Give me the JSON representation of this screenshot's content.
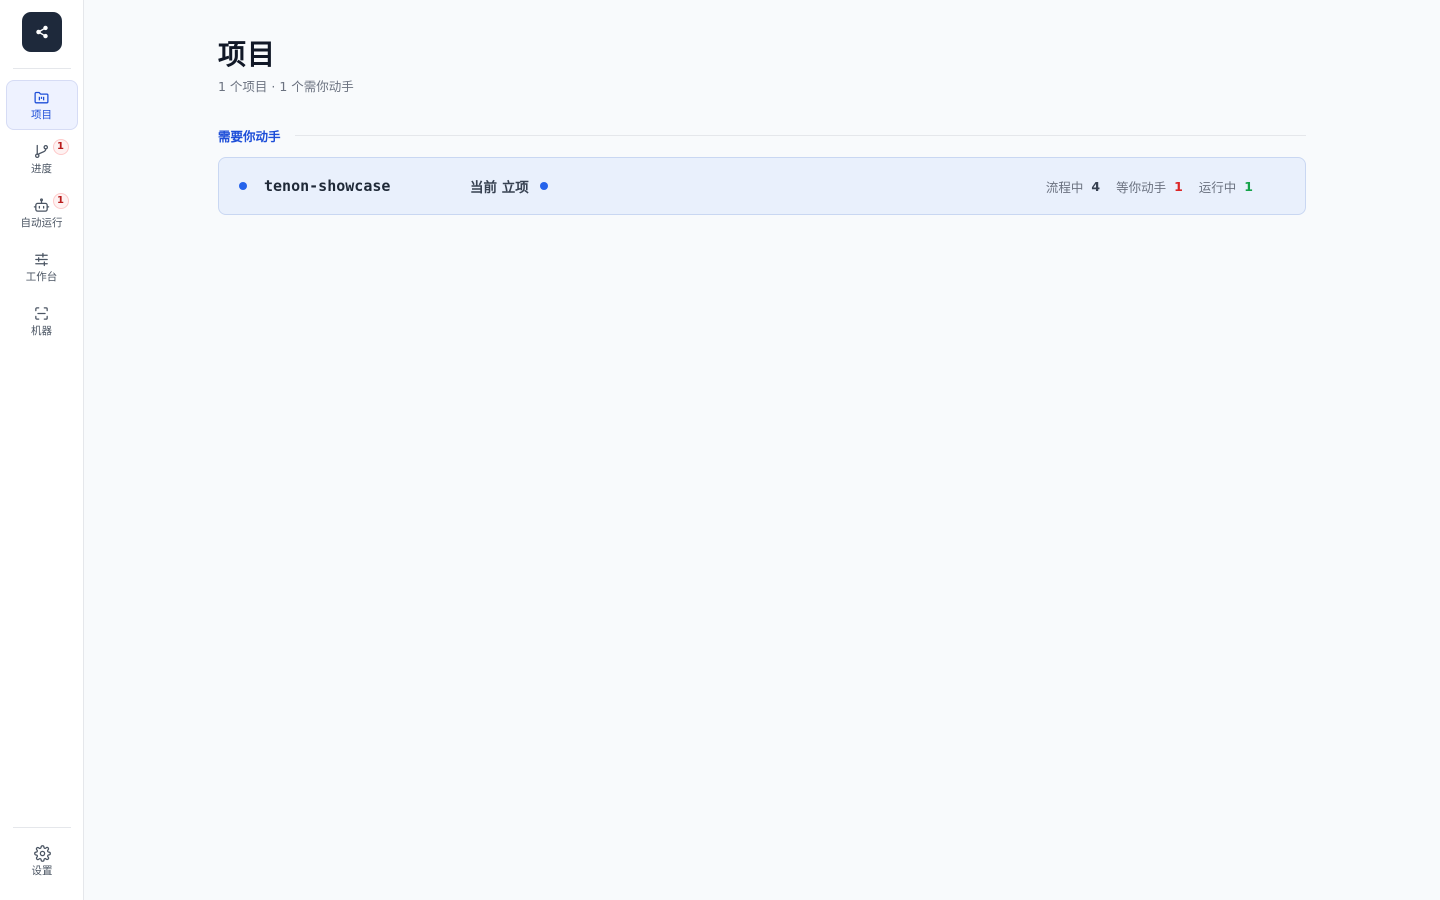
{
  "sidebar": {
    "items": [
      {
        "label": "项目",
        "icon": "folder-icon",
        "active": true,
        "badge": ""
      },
      {
        "label": "进度",
        "icon": "git-branch-icon",
        "active": false,
        "badge": "1"
      },
      {
        "label": "自动运行",
        "icon": "bot-icon",
        "active": false,
        "badge": "1"
      },
      {
        "label": "工作台",
        "icon": "sliders-icon",
        "active": false,
        "badge": ""
      },
      {
        "label": "机器",
        "icon": "scan-icon",
        "active": false,
        "badge": ""
      }
    ],
    "settings_label": "设置"
  },
  "page": {
    "title": "项目",
    "subtitle": "1 个项目 · 1 个需你动手"
  },
  "section": {
    "label": "需要你动手"
  },
  "project": {
    "name": "tenon-showcase",
    "stage": "当前 立项",
    "stage_note": "",
    "stats": [
      {
        "label": "流程中",
        "value": "4",
        "color": "#374151"
      },
      {
        "label": "等你动手",
        "value": "1",
        "color": "#dc2626"
      },
      {
        "label": "运行中",
        "value": "1",
        "color": "#16a34a"
      }
    ]
  },
  "colors": {
    "accent": "#1d4ed8",
    "dot": "#2563eb",
    "logo_bg": "#1e293b",
    "card_bg": "#e9f0fc"
  }
}
